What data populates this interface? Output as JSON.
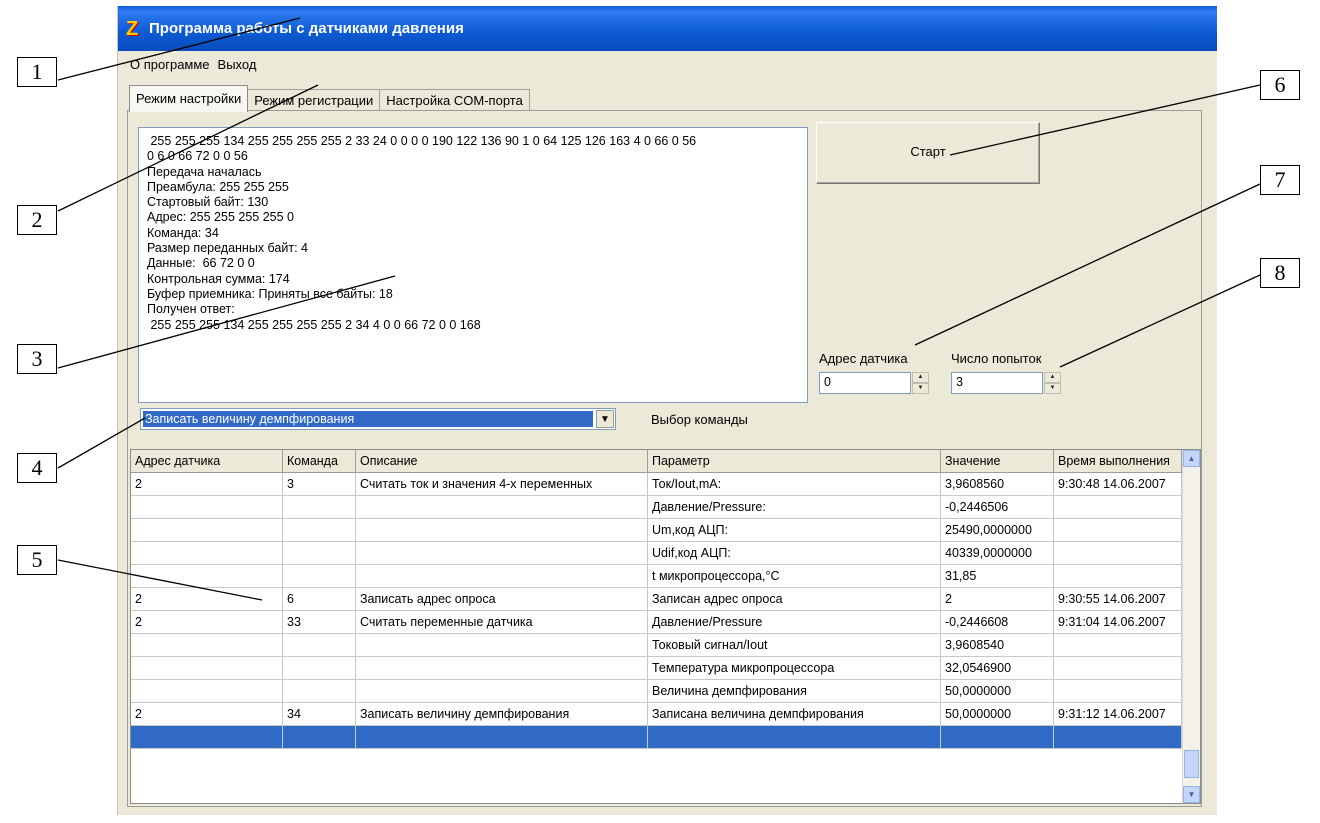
{
  "window": {
    "title": "Программа работы с датчиками давления",
    "icon": "z-app-icon"
  },
  "menu": [
    "О программе",
    "Выход"
  ],
  "tabs": [
    "Режим настройки",
    "Режим регистрации",
    "Настройка COM-порта"
  ],
  "log_lines": [
    " 255 255 255 134 255 255 255 255 2 33 24 0 0 0 0 190 122 136 90 1 0 64 125 126 163 4 0 66 0 56",
    "0 6 0 66 72 0 0 56",
    "Передача началась",
    "Преамбула: 255 255 255",
    "Стартовый байт: 130",
    "Адрес: 255 255 255 255 0",
    "Команда: 34",
    "Размер переданных байт: 4",
    "Данные:  66 72 0 0",
    "Контрольная сумма: 174",
    "Буфер приемника: Приняты все байты: 18",
    "Получен ответ:",
    " 255 255 255 134 255 255 255 255 2 34 4 0 0 66 72 0 0 168"
  ],
  "start_label": "Старт",
  "address_label": "Адрес датчика",
  "address_value": "0",
  "attempts_label": "Число попыток",
  "attempts_value": "3",
  "command_selected": "Записать величину демпфирования",
  "command_label": "Выбор команды",
  "grid": {
    "headers": [
      "Адрес датчика",
      "Команда",
      "Описание",
      "Параметр",
      "Значение",
      "Время выполнения"
    ],
    "rows": [
      [
        "2",
        "3",
        "Считать ток и значения 4-х переменных",
        "Ток/Iout,mA:",
        "3,9608560",
        "9:30:48 14.06.2007"
      ],
      [
        "",
        "",
        "",
        "Давление/Pressure:",
        "-0,2446506",
        ""
      ],
      [
        "",
        "",
        "",
        "Um,код АЦП:",
        "25490,0000000",
        ""
      ],
      [
        "",
        "",
        "",
        "Udif,код АЦП:",
        "40339,0000000",
        ""
      ],
      [
        "",
        "",
        "",
        "t микропроцессора,°C",
        "31,85",
        ""
      ],
      [
        "2",
        "6",
        "Записать адрес опроса",
        "Записан адрес опроса",
        "2",
        "9:30:55 14.06.2007"
      ],
      [
        "2",
        "33",
        "Считать переменные датчика",
        "Давление/Pressure",
        "-0,2446608",
        "9:31:04 14.06.2007"
      ],
      [
        "",
        "",
        "",
        "Токовый сигнал/Iout",
        "3,9608540",
        ""
      ],
      [
        "",
        "",
        "",
        "Температура микропроцессора",
        "32,0546900",
        ""
      ],
      [
        "",
        "",
        "",
        "Величина демпфирования",
        "50,0000000",
        ""
      ],
      [
        "2",
        "34",
        "Записать величину демпфирования",
        "Записана величина демпфирования",
        "50,0000000",
        "9:31:12 14.06.2007"
      ],
      [
        "",
        "",
        "",
        "",
        "",
        ""
      ]
    ]
  },
  "callouts": [
    "1",
    "2",
    "3",
    "4",
    "5",
    "6",
    "7",
    "8"
  ]
}
